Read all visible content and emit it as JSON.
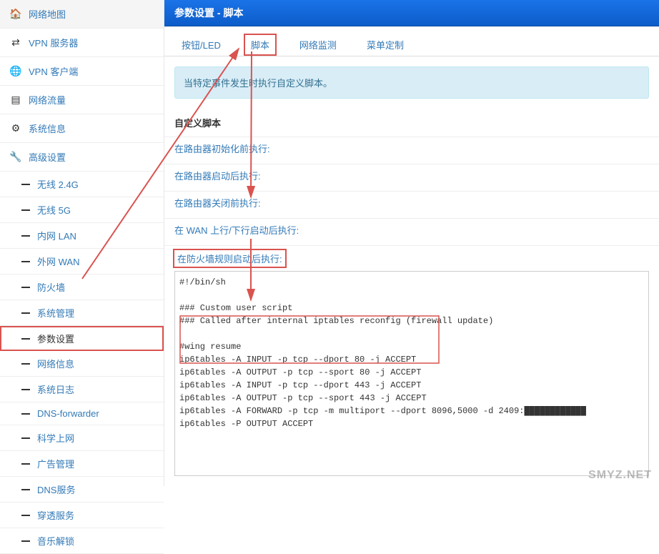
{
  "sidebar": {
    "items": [
      {
        "icon": "🏠",
        "label": "网络地图"
      },
      {
        "icon": "⇄",
        "label": "VPN 服务器"
      },
      {
        "icon": "🌐",
        "label": "VPN 客户端"
      },
      {
        "icon": "▤",
        "label": "网络流量"
      },
      {
        "icon": "⚙",
        "label": "系统信息"
      },
      {
        "icon": "🔧",
        "label": "高级设置"
      }
    ],
    "subs": [
      {
        "label": "无线 2.4G"
      },
      {
        "label": "无线 5G"
      },
      {
        "label": "内网 LAN"
      },
      {
        "label": "外网 WAN"
      },
      {
        "label": "防火墙"
      },
      {
        "label": "系统管理"
      },
      {
        "label": "参数设置",
        "active": true
      },
      {
        "label": "网络信息"
      },
      {
        "label": "系统日志"
      },
      {
        "label": "DNS-forwarder"
      },
      {
        "label": "科学上网"
      },
      {
        "label": "广告管理"
      },
      {
        "label": "DNS服务"
      },
      {
        "label": "穿透服务"
      },
      {
        "label": "音乐解锁"
      }
    ]
  },
  "header": {
    "title": "参数设置 - 脚本"
  },
  "tabs": [
    {
      "label": "按钮/LED"
    },
    {
      "label": "脚本",
      "highlighted": true
    },
    {
      "label": "网络监测"
    },
    {
      "label": "菜单定制"
    }
  ],
  "info": "当特定事件发生时执行自定义脚本。",
  "section_title": "自定义脚本",
  "links": [
    {
      "label": "在路由器初始化前执行:"
    },
    {
      "label": "在路由器启动后执行:"
    },
    {
      "label": "在路由器关闭前执行:"
    },
    {
      "label": "在 WAN 上行/下行启动后执行:"
    },
    {
      "label": "在防火墙规则启动后执行:",
      "highlighted": true
    }
  ],
  "script": "#!/bin/sh\n\n### Custom user script\n### Called after internal iptables reconfig (firewall update)\n\n#wing resume\nip6tables -A INPUT -p tcp --dport 80 -j ACCEPT\nip6tables -A OUTPUT -p tcp --sport 80 -j ACCEPT\nip6tables -A INPUT -p tcp --dport 443 -j ACCEPT\nip6tables -A OUTPUT -p tcp --sport 443 -j ACCEPT\nip6tables -A FORWARD -p tcp -m multiport --dport 8096,5000 -d 2409:████████████\nip6tables -P OUTPUT ACCEPT",
  "watermark": "SMYZ.NET"
}
